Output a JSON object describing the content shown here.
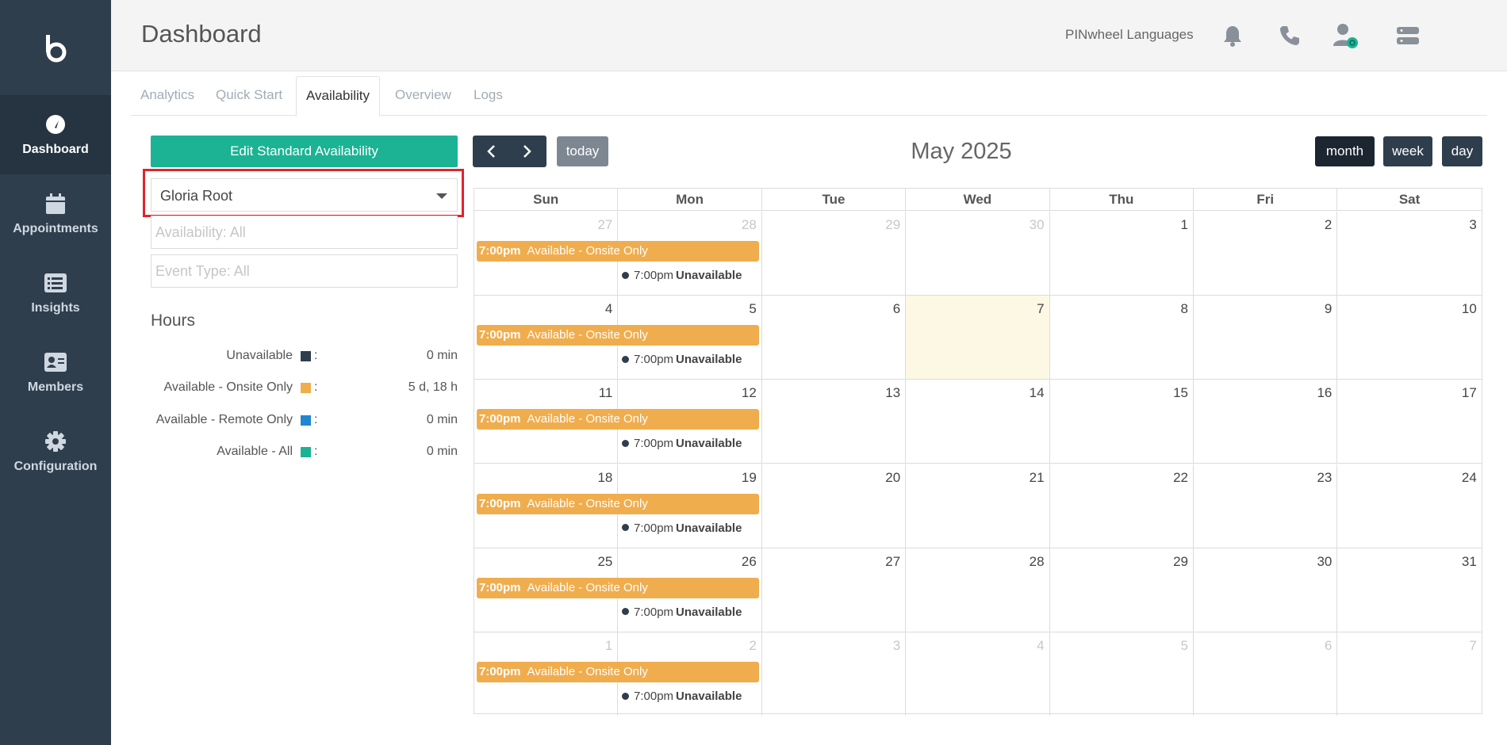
{
  "app": {
    "page_title": "Dashboard",
    "org_name": "PINwheel Languages"
  },
  "colors": {
    "sidebar_bg": "#2f3e4d",
    "accent_green": "#1bb394",
    "event_orange": "#f0ad4e",
    "highlight_red": "#e0232b",
    "unavailable": "#2f3e4d",
    "onsite": "#f0ad4e",
    "remote": "#2185d0",
    "all": "#1bb394"
  },
  "sidebar": {
    "items": [
      {
        "label": "Dashboard",
        "icon": "speedometer-icon",
        "active": true
      },
      {
        "label": "Appointments",
        "icon": "calendar-icon",
        "active": false
      },
      {
        "label": "Insights",
        "icon": "list-icon",
        "active": false
      },
      {
        "label": "Members",
        "icon": "id-card-icon",
        "active": false
      },
      {
        "label": "Configuration",
        "icon": "gear-icon",
        "active": false
      }
    ]
  },
  "header": {
    "icons": [
      "bell-icon",
      "phone-icon",
      "user-status-icon",
      "server-icon"
    ]
  },
  "tabs": [
    {
      "label": "Analytics",
      "active": false
    },
    {
      "label": "Quick Start",
      "active": false
    },
    {
      "label": "Availability",
      "active": true
    },
    {
      "label": "Overview",
      "active": false
    },
    {
      "label": "Logs",
      "active": false
    }
  ],
  "left_panel": {
    "edit_button": "Edit Standard Availability",
    "member_select": "Gloria Root",
    "availability_filter": "Availability: All",
    "event_type_filter": "Event Type: All",
    "hours_title": "Hours",
    "hours": [
      {
        "label": "Unavailable",
        "value": "0 min"
      },
      {
        "label": "Available - Onsite Only",
        "value": "5 d, 18 h"
      },
      {
        "label": "Available - Remote Only",
        "value": "0 min"
      },
      {
        "label": "Available - All",
        "value": "0 min"
      }
    ]
  },
  "calendar": {
    "title": "May 2025",
    "today_label": "today",
    "views": [
      "month",
      "week",
      "day"
    ],
    "active_view": "month",
    "weekdays": [
      "Sun",
      "Mon",
      "Tue",
      "Wed",
      "Thu",
      "Fri",
      "Sat"
    ],
    "weeks": [
      [
        "27",
        "28",
        "29",
        "30",
        "1",
        "2",
        "3"
      ],
      [
        "4",
        "5",
        "6",
        "7",
        "8",
        "9",
        "10"
      ],
      [
        "11",
        "12",
        "13",
        "14",
        "15",
        "16",
        "17"
      ],
      [
        "18",
        "19",
        "20",
        "21",
        "22",
        "23",
        "24"
      ],
      [
        "25",
        "26",
        "27",
        "28",
        "29",
        "30",
        "31"
      ],
      [
        "1",
        "2",
        "3",
        "4",
        "5",
        "6",
        "7"
      ]
    ],
    "today_date": "7",
    "event_bar": {
      "time": "7:00pm",
      "title": "Available - Onsite Only"
    },
    "event_dot": {
      "time": "7:00pm",
      "title": "Unavailable"
    }
  }
}
